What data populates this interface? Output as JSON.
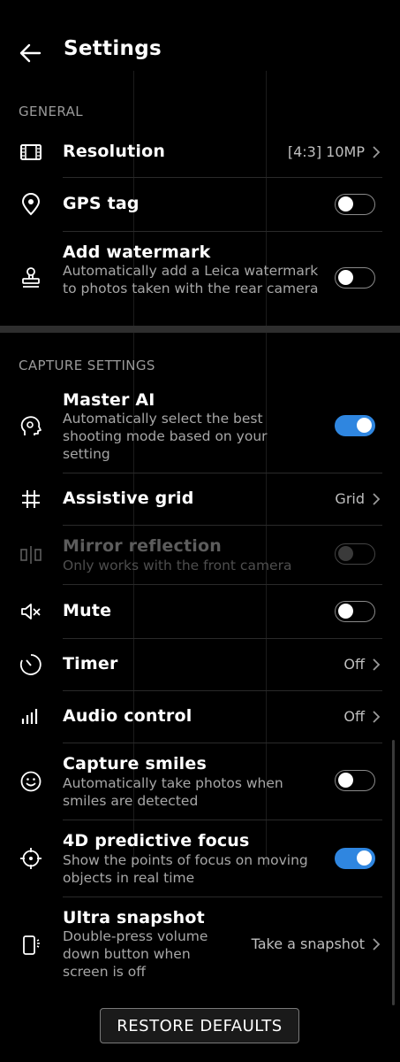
{
  "header": {
    "title": "Settings"
  },
  "sections": {
    "general": "GENERAL",
    "capture": "CAPTURE SETTINGS"
  },
  "general": {
    "resolution": {
      "label": "Resolution",
      "value": "[4:3] 10MP"
    },
    "gps": {
      "label": "GPS tag",
      "toggle": false
    },
    "watermark": {
      "label": "Add watermark",
      "desc": "Automatically add a Leica watermark to photos taken with the rear camera",
      "toggle": false
    }
  },
  "capture": {
    "master_ai": {
      "label": "Master AI",
      "desc": "Automatically select the best shooting mode based on your setting",
      "toggle": true
    },
    "grid": {
      "label": "Assistive grid",
      "value": "Grid"
    },
    "mirror": {
      "label": "Mirror reflection",
      "desc": "Only works with the front camera",
      "toggle": false,
      "disabled": true
    },
    "mute": {
      "label": "Mute",
      "toggle": false
    },
    "timer": {
      "label": "Timer",
      "value": "Off"
    },
    "audio": {
      "label": "Audio control",
      "value": "Off"
    },
    "smiles": {
      "label": "Capture smiles",
      "desc": "Automatically take photos when smiles are detected",
      "toggle": false
    },
    "focus4d": {
      "label": "4D predictive focus",
      "desc": "Show the points of focus on moving objects in real time",
      "toggle": true
    },
    "snapshot": {
      "label": "Ultra snapshot",
      "desc": "Double-press volume down button when screen is off",
      "value": "Take a snapshot"
    }
  },
  "footer": {
    "restore_label": "RESTORE DEFAULTS"
  },
  "colors": {
    "accent": "#2f86e0",
    "background": "#000000"
  }
}
